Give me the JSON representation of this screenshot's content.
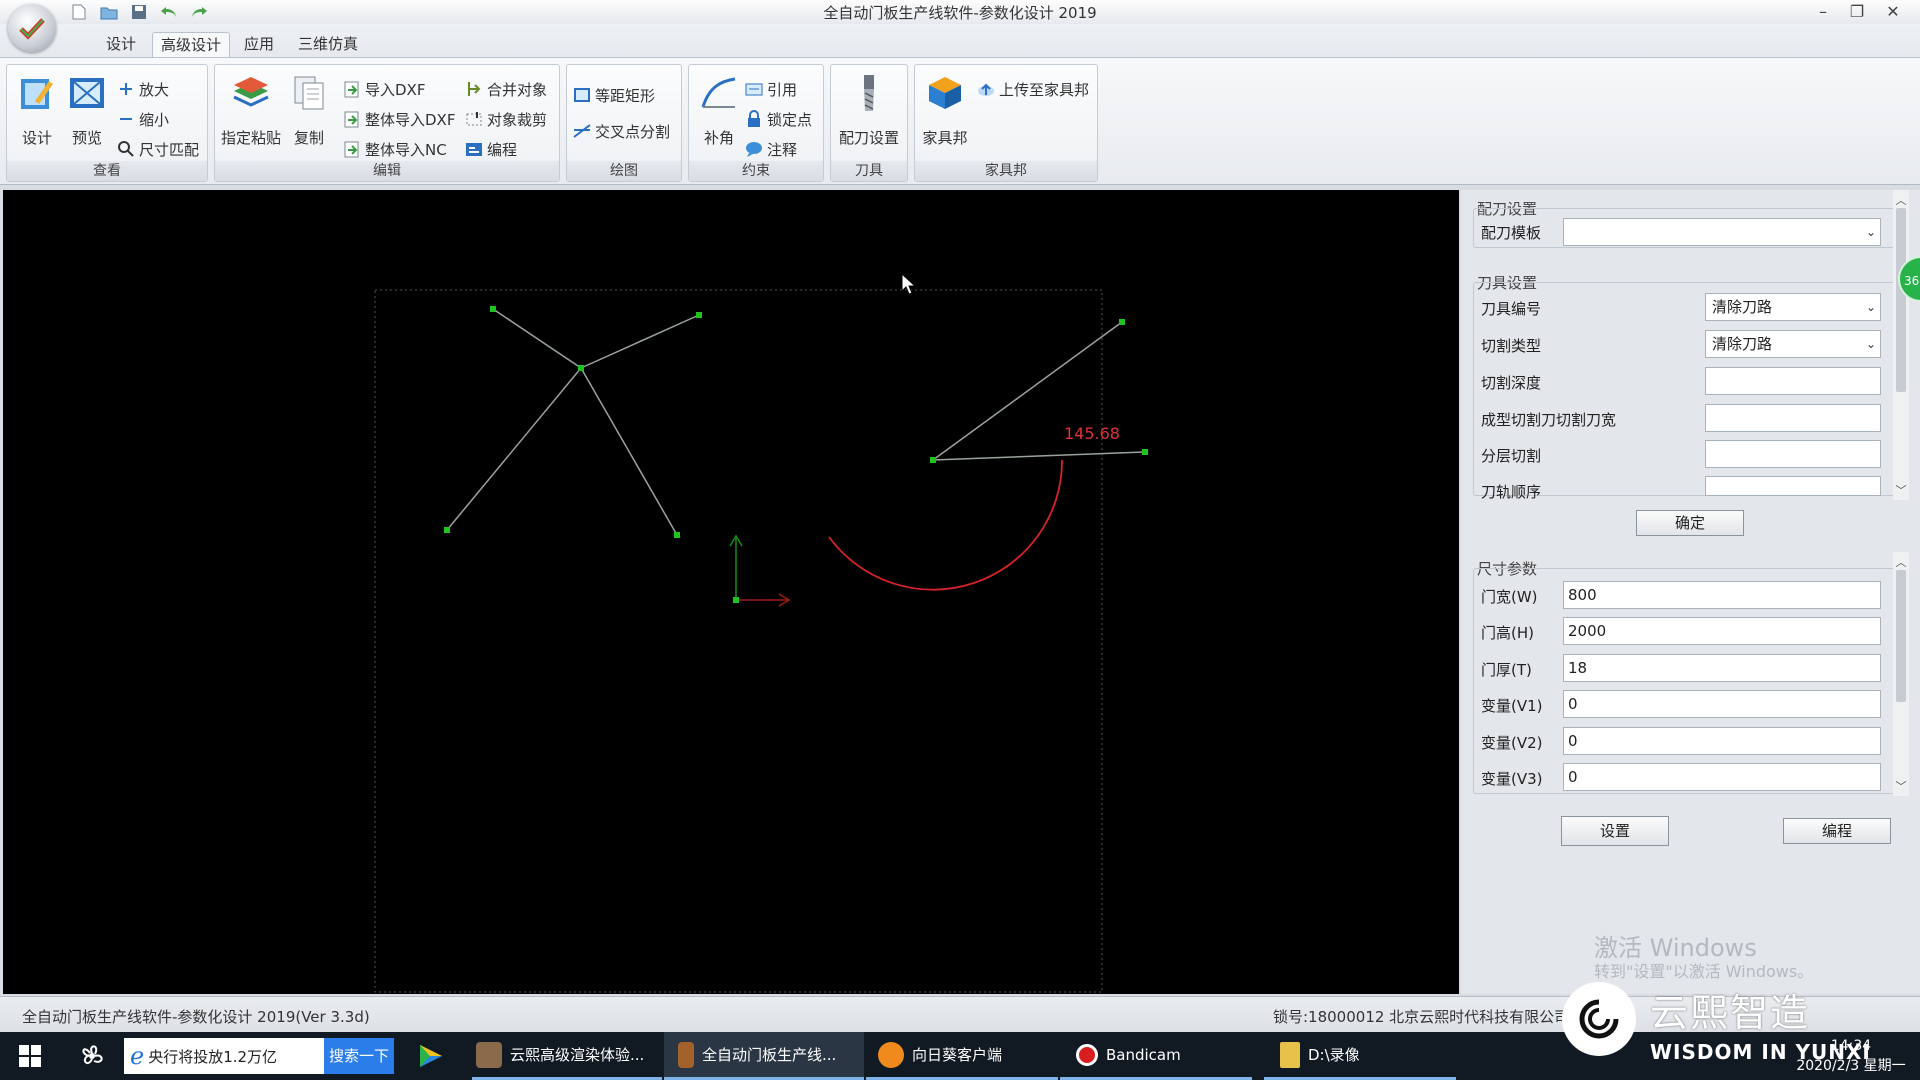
{
  "window": {
    "title": "全自动门板生产线软件-参数化设计 2019",
    "min_glyph": "–",
    "restore_glyph": "❐",
    "close_glyph": "✕"
  },
  "tabs": [
    "设计",
    "高级设计",
    "应用",
    "三维仿真"
  ],
  "ribbon": {
    "view": {
      "label": "查看",
      "design": "设计",
      "preview": "预览",
      "zoom_in": "放大",
      "zoom_out": "缩小",
      "fit": "尺寸匹配"
    },
    "edit": {
      "label": "编辑",
      "paste": "指定粘贴",
      "copy": "复制",
      "import_dxf": "导入DXF",
      "import_all_dxf": "整体导入DXF",
      "import_all_nc": "整体导入NC",
      "merge": "合并对象",
      "trim": "对象裁剪",
      "program": "编程"
    },
    "draw": {
      "label": "绘图",
      "equal_rect": "等距矩形",
      "cross_split": "交叉点分割"
    },
    "constraint": {
      "label": "约束",
      "fillet": "补角",
      "reference": "引用",
      "lock_point": "锁定点",
      "annotate": "注释"
    },
    "tool": {
      "label": "刀具",
      "tool_setup": "配刀设置"
    },
    "furniture": {
      "label": "家具邦",
      "home": "家具邦",
      "upload": "上传至家具邦"
    }
  },
  "canvas": {
    "dimension_label": "145.68",
    "colors": {
      "background": "#000000",
      "line": "#9aa39a",
      "node": "#1fc41f",
      "arc": "#d8222a",
      "frame": "#555555"
    }
  },
  "panel": {
    "tool_config": {
      "title": "配刀设置",
      "template_label": "配刀模板",
      "template_value": ""
    },
    "tool_settings": {
      "title": "刀具设置",
      "rows": [
        {
          "label": "刀具编号",
          "value": "清除刀路",
          "kind": "combo"
        },
        {
          "label": "切割类型",
          "value": "清除刀路",
          "kind": "combo"
        },
        {
          "label": "切割深度",
          "value": "",
          "kind": "field"
        },
        {
          "label": "成型切割刀切割刀宽",
          "value": "",
          "kind": "field"
        },
        {
          "label": "分层切割",
          "value": "",
          "kind": "field"
        },
        {
          "label": "刀轨顺序",
          "value": "",
          "kind": "field"
        }
      ],
      "confirm": "确定"
    },
    "size_params": {
      "title": "尺寸参数",
      "rows": [
        {
          "label": "门宽(W)",
          "value": "800"
        },
        {
          "label": "门高(H)",
          "value": "2000"
        },
        {
          "label": "门厚(T)",
          "value": "18"
        },
        {
          "label": "变量(V1)",
          "value": "0"
        },
        {
          "label": "变量(V2)",
          "value": "0"
        },
        {
          "label": "变量(V3)",
          "value": "0"
        }
      ],
      "set_button": "设置",
      "program_button": "编程"
    },
    "badge": "36",
    "activation_title": "激活 Windows",
    "activation_sub": "转到\"设置\"以激活 Windows。"
  },
  "statusbar": {
    "left": "全自动门板生产线软件-参数化设计 2019(Ver 3.3d)",
    "right": "锁号:18000012 北京云熙时代科技有限公司"
  },
  "watermark": {
    "cn": "云熙智造",
    "en": "WISDOM IN YUNXI"
  },
  "taskbar": {
    "news_text": "央行将投放1.2万亿",
    "news_button": "搜索一下",
    "items": [
      {
        "label": "云熙高级渲染体验...",
        "color": "#8a6a4a"
      },
      {
        "label": "全自动门板生产线...",
        "color": "#a3622a"
      },
      {
        "label": "向日葵客户端",
        "color": "#f08a1c"
      },
      {
        "label": "Bandicam",
        "color": "#d81e1e"
      },
      {
        "label": "D:\\录像",
        "color": "#e8c14a"
      }
    ],
    "time": "14:34",
    "date": "2020/2/3 星期一"
  }
}
